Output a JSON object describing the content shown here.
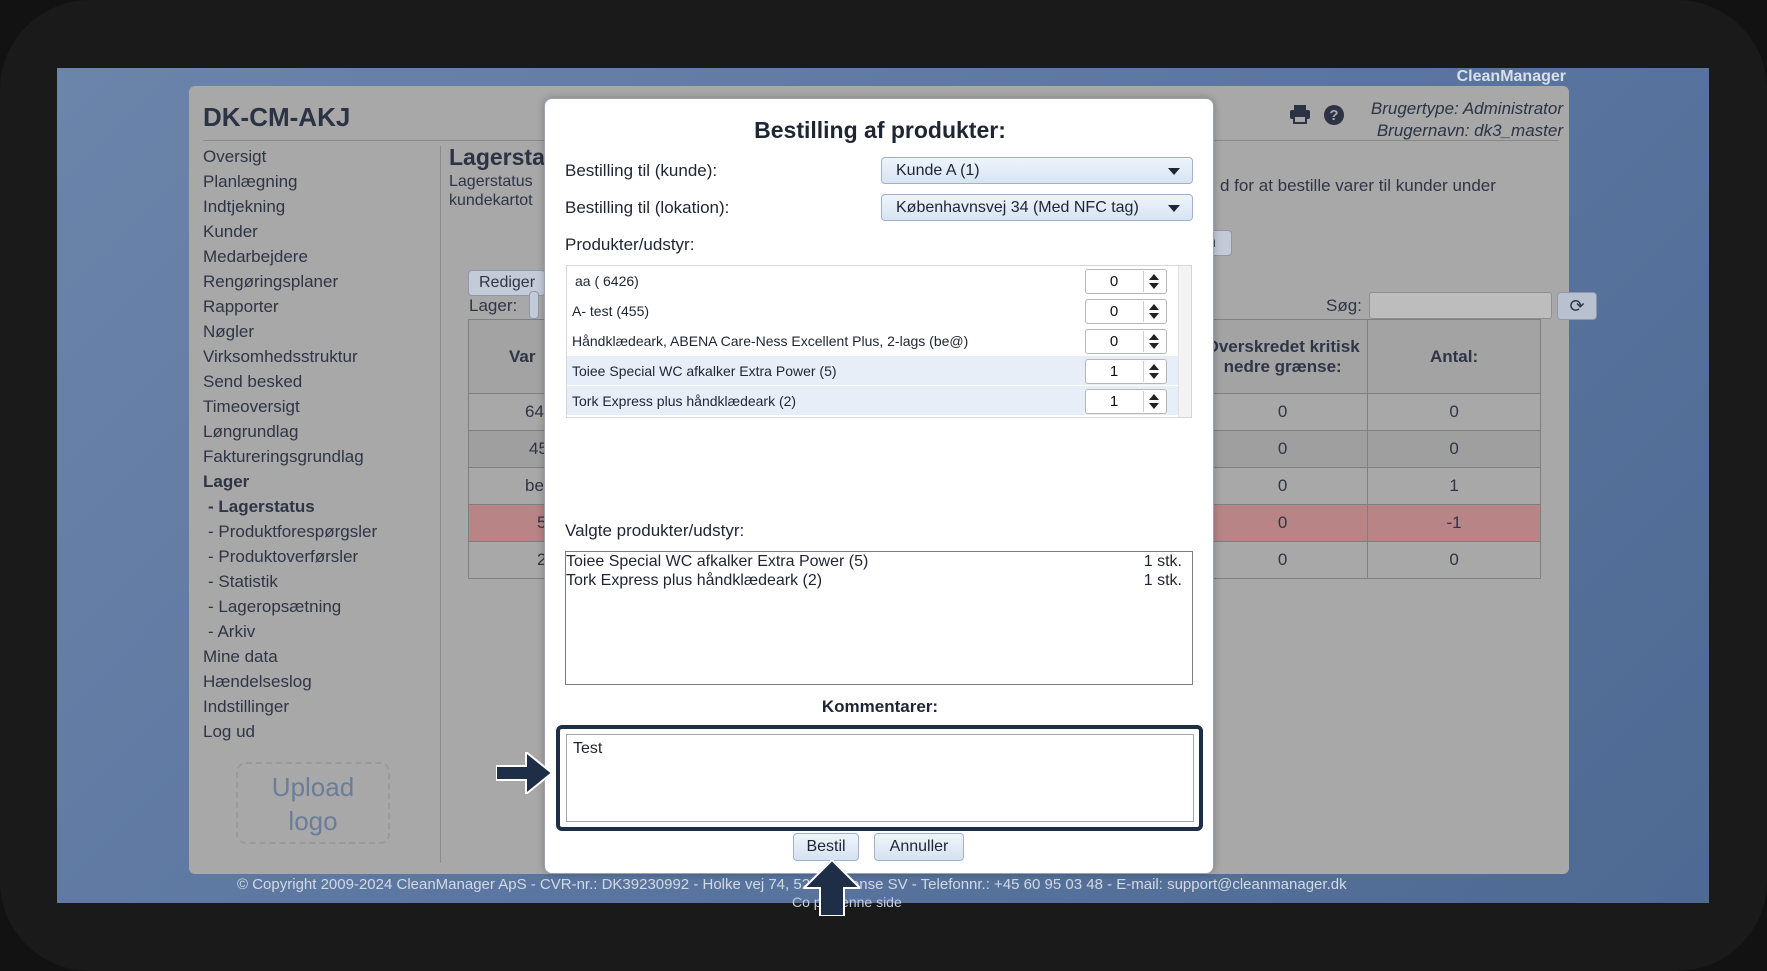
{
  "brand": "CleanManager",
  "app": {
    "title": "DK-CM-AKJ",
    "user_type": "Brugertype: Administrator",
    "user_name": "Brugernavn: dk3_master"
  },
  "nav": {
    "items": [
      {
        "label": "Oversigt"
      },
      {
        "label": "Planlægning"
      },
      {
        "label": "Indtjekning"
      },
      {
        "label": "Kunder"
      },
      {
        "label": "Medarbejdere"
      },
      {
        "label": "Rengøringsplaner"
      },
      {
        "label": "Rapporter"
      },
      {
        "label": "Nøgler"
      },
      {
        "label": "Virksomhedsstruktur"
      },
      {
        "label": "Send besked"
      },
      {
        "label": "Timeoversigt"
      },
      {
        "label": "Løngrundlag"
      },
      {
        "label": "Faktureringsgrundlag"
      },
      {
        "label": "Lager"
      },
      {
        "label": "- Lagerstatus"
      },
      {
        "label": "- Produktforespørgsler"
      },
      {
        "label": "- Produktoverførsler"
      },
      {
        "label": "- Statistik"
      },
      {
        "label": "- Lageropsætning"
      },
      {
        "label": "- Arkiv"
      },
      {
        "label": "Mine data"
      },
      {
        "label": "Hændelseslog"
      },
      {
        "label": "Indstillinger"
      },
      {
        "label": "Log ud"
      }
    ],
    "upload_logo_line1": "Upload",
    "upload_logo_line2": "logo"
  },
  "main": {
    "title": "Lagersta",
    "desc_line1": "Lagerstatus",
    "desc_line2": "kundekartot",
    "desc_right": "d for at bestille varer til kunder under",
    "edit_button": "Rediger",
    "partial_button": "n",
    "lager_label": "Lager:",
    "search_label": "Søg:",
    "table": {
      "col_first": "Var",
      "col_critical": "Overskredet kritisk nedre grænse:",
      "col_antal": "Antal:",
      "rows": [
        {
          "first": "64",
          "critical": "0",
          "antal": "0"
        },
        {
          "first": "45",
          "critical": "0",
          "antal": "0"
        },
        {
          "first": "be",
          "critical": "0",
          "antal": "1"
        },
        {
          "first": "5",
          "critical": "0",
          "antal": "-1"
        },
        {
          "first": "2",
          "critical": "0",
          "antal": "0"
        }
      ]
    }
  },
  "footer": {
    "line1": "© Copyright 2009-2024 CleanManager ApS - CVR-nr.: DK39230992 - Holke      vej 74, 5250 Odense SV - Telefonnr.: +45 60 95 03 48 - E-mail: support@cleanmanager.dk",
    "line2": "Co         på denne side"
  },
  "modal": {
    "title": "Bestilling af produkter:",
    "customer_label": "Bestilling til (kunde):",
    "customer_value": "Kunde A (1)",
    "location_label": "Bestilling til (lokation):",
    "location_value": "Københavnsvej 34 (Med NFC tag)",
    "products_label": "Produkter/udstyr:",
    "products": [
      {
        "name": "aa ( 6426)",
        "qty": "0"
      },
      {
        "name": "A- test (455)",
        "qty": "0"
      },
      {
        "name": "Håndklædeark, ABENA Care-Ness Excellent Plus, 2-lags (be@)",
        "qty": "0"
      },
      {
        "name": "Toiee Special WC afkalker Extra Power (5)",
        "qty": "1"
      },
      {
        "name": "Tork Express plus håndklædeark (2)",
        "qty": "1"
      }
    ],
    "chosen_label": "Valgte produkter/udstyr:",
    "chosen": [
      {
        "name": "Toiee Special WC afkalker Extra Power (5)",
        "qty": "1 stk."
      },
      {
        "name": "Tork Express plus håndklædeark (2)",
        "qty": "1 stk."
      }
    ],
    "comment_label": "Kommentarer:",
    "comment_value": "Test",
    "order_button": "Bestil",
    "cancel_button": "Annuller"
  },
  "colors": {
    "desktop": "#5b76a0",
    "app_panel": "#a8a8a8",
    "highlight_row": "#b98486",
    "callout": "#1f2e47"
  }
}
